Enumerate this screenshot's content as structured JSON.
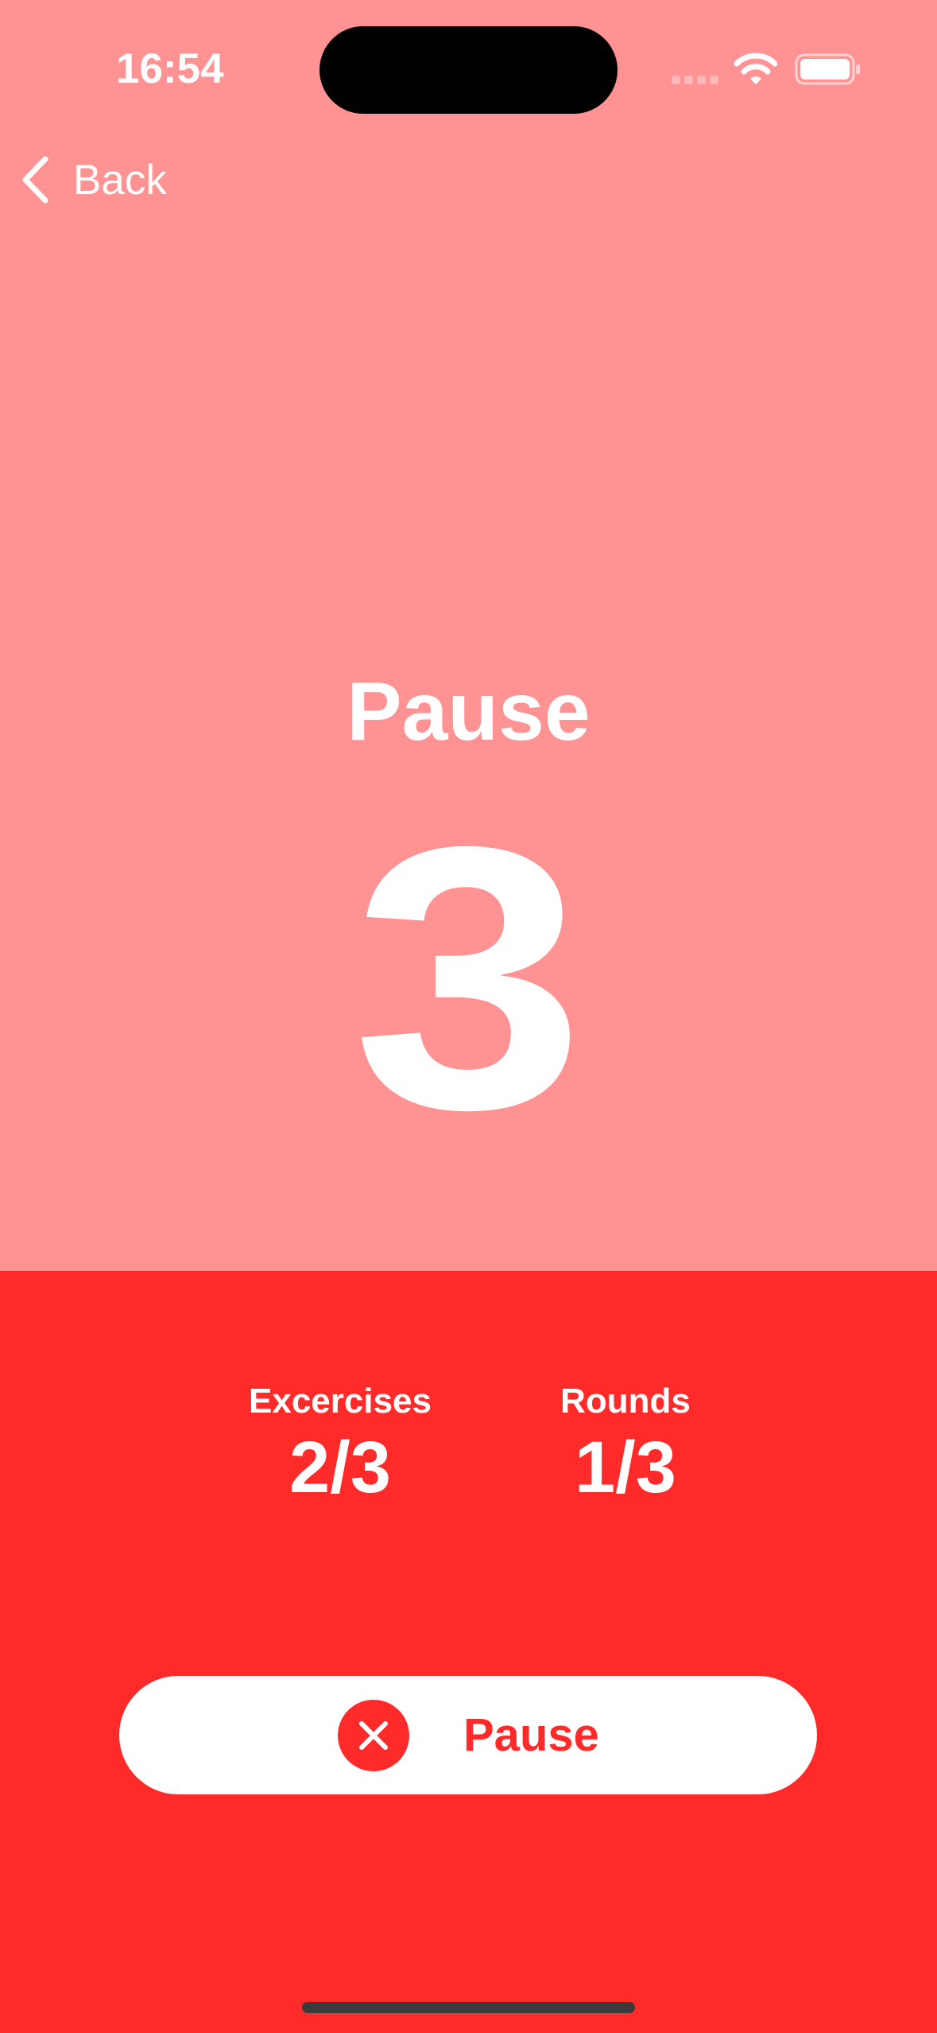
{
  "colors": {
    "top_background": "#ff9292",
    "bottom_background": "#ff2b2b",
    "accent": "#ff2b2b",
    "button_background": "#ffffff",
    "text": "#ffffff"
  },
  "status_bar": {
    "time": "16:54",
    "icons": [
      "cellular-signal-icon",
      "wifi-icon",
      "battery-icon"
    ]
  },
  "nav": {
    "back_label": "Back",
    "back_icon": "chevron-left-icon"
  },
  "timer": {
    "phase": "Pause",
    "countdown": "3"
  },
  "stats": {
    "exercises": {
      "label": "Excercises",
      "value": "2/3"
    },
    "rounds": {
      "label": "Rounds",
      "value": "1/3"
    }
  },
  "action_button": {
    "icon": "close-icon",
    "label": "Pause"
  }
}
